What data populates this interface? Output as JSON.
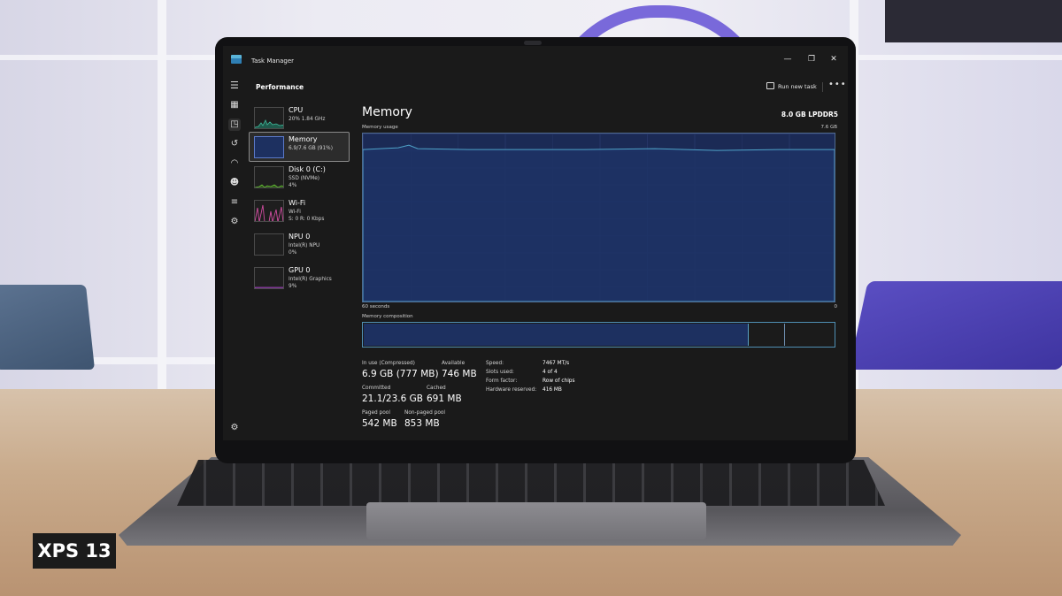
{
  "window": {
    "title": "Task Manager",
    "minimize_glyph": "—",
    "maximize_glyph": "❐",
    "close_glyph": "✕"
  },
  "header": {
    "page_title": "Performance",
    "run_new_task": "Run new task",
    "more": "•••"
  },
  "nav": {
    "icons": [
      "hamburger-icon",
      "processes-icon",
      "performance-icon",
      "app-history-icon",
      "startup-apps-icon",
      "users-icon",
      "details-icon",
      "services-icon",
      "settings-icon"
    ],
    "active": "performance-icon"
  },
  "resources": [
    {
      "name": "CPU",
      "line1": "20%  1.84 GHz",
      "line2": "",
      "color": "#3fb89a"
    },
    {
      "name": "Memory",
      "line1": "6.9/7.6 GB (91%)",
      "line2": "",
      "color": "#5b79c8"
    },
    {
      "name": "Disk 0 (C:)",
      "line1": "SSD (NVMe)",
      "line2": "4%",
      "color": "#6ac23a"
    },
    {
      "name": "Wi-Fi",
      "line1": "Wi-Fi",
      "line2": "S: 0  R: 0 Kbps",
      "color": "#d04ca0"
    },
    {
      "name": "NPU 0",
      "line1": "Intel(R) NPU",
      "line2": "0%",
      "color": "#3a9ad0"
    },
    {
      "name": "GPU 0",
      "line1": "Intel(R) Graphics",
      "line2": "9%",
      "color": "#b44ad0"
    }
  ],
  "memory": {
    "title": "Memory",
    "total": "8.0 GB LPDDR5",
    "usage_label": "Memory usage",
    "usage_max": "7.6 GB",
    "x_left": "60 seconds",
    "x_right": "0",
    "composition_label": "Memory composition",
    "composition": {
      "in_use_fraction": 0.91,
      "modified_fraction": 0.09
    },
    "usage_fraction": 0.91,
    "stats": {
      "in_use_label": "In use (Compressed)",
      "in_use_value": "6.9 GB (777 MB)",
      "available_label": "Available",
      "available_value": "746 MB",
      "committed_label": "Committed",
      "committed_value": "21.1/23.6 GB",
      "cached_label": "Cached",
      "cached_value": "691 MB",
      "paged_label": "Paged pool",
      "paged_value": "542 MB",
      "nonpaged_label": "Non-paged pool",
      "nonpaged_value": "853 MB"
    },
    "details": {
      "speed_label": "Speed:",
      "speed_value": "7467 MT/s",
      "slots_label": "Slots used:",
      "slots_value": "4 of 4",
      "form_label": "Form factor:",
      "form_value": "Row of chips",
      "reserved_label": "Hardware reserved:",
      "reserved_value": "416 MB"
    }
  },
  "badge": {
    "text": "XPS 13"
  },
  "colors": {
    "graph_fill": "#1b2a55",
    "graph_line": "#4fa3c8",
    "accent_border": "#4f8fb4"
  }
}
